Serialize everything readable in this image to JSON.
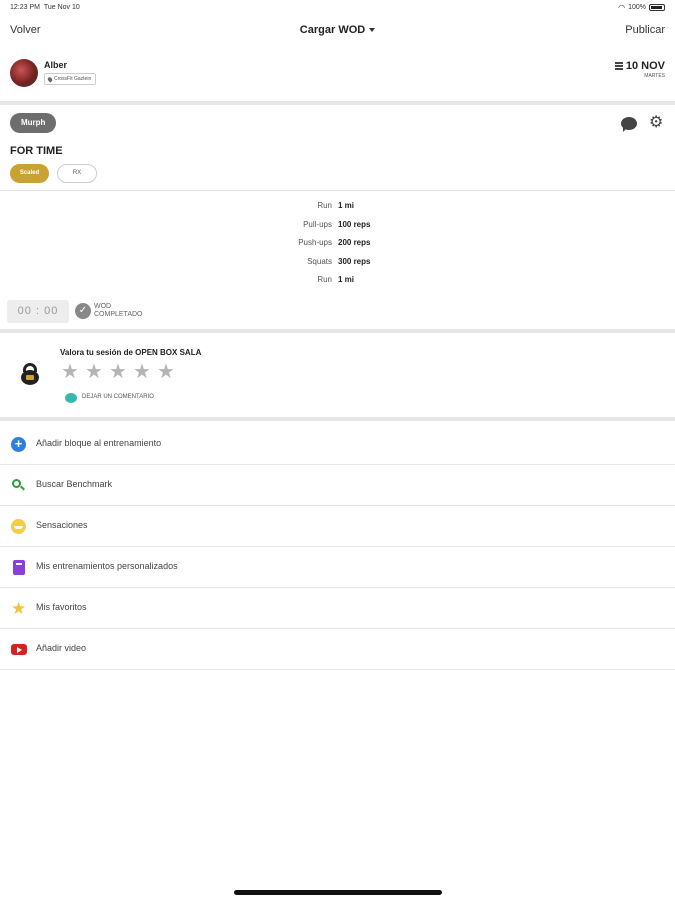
{
  "status_bar": {
    "time": "12:23 PM",
    "date": "Tue Nov 10",
    "wifi_icon": "wifi-icon",
    "battery_percent": "100%"
  },
  "nav": {
    "back_label": "Volver",
    "title": "Cargar WOD",
    "publish_label": "Publicar"
  },
  "user": {
    "name": "Alber",
    "box": "CrossFit Gaztein",
    "date_main": "10 NOV",
    "date_sub": "MARTES"
  },
  "wod": {
    "name": "Murph",
    "type": "FOR TIME",
    "tags": [
      "Scaled",
      "RX"
    ],
    "selected_tag": "Scaled",
    "exercises": [
      {
        "name": "Run",
        "qty": "1 mi"
      },
      {
        "name": "Pull-ups",
        "qty": "100 reps"
      },
      {
        "name": "Push-ups",
        "qty": "200 reps"
      },
      {
        "name": "Squats",
        "qty": "300 reps"
      },
      {
        "name": "Run",
        "qty": "1 mi"
      }
    ],
    "timer": "00 : 00",
    "completed_line1": "WOD",
    "completed_line2": "COMPLETADO"
  },
  "rating": {
    "title": "Valora tu sesión de OPEN BOX SALA",
    "stars": 5,
    "value": 0,
    "comment_label": "DEJAR UN COMENTARIO"
  },
  "menu": [
    {
      "label": "Añadir bloque al entrenamiento",
      "icon": "plus-circle-icon",
      "color": "#2d7fe0"
    },
    {
      "label": "Buscar Benchmark",
      "icon": "search-icon",
      "color": "#2c9b3c"
    },
    {
      "label": "Sensaciones",
      "icon": "smiley-icon",
      "color": "#f5cb4a"
    },
    {
      "label": "Mis entrenamientos personalizados",
      "icon": "notebook-icon",
      "color": "#8a3fd8"
    },
    {
      "label": "Mis favoritos",
      "icon": "star-icon",
      "color": "#f3c532"
    },
    {
      "label": "Añadir video",
      "icon": "video-play-icon",
      "color": "#d82020"
    }
  ],
  "colors": {
    "accent": "#c9a233",
    "pill": "#6d6d6d",
    "divider": "#e6e6e6"
  }
}
